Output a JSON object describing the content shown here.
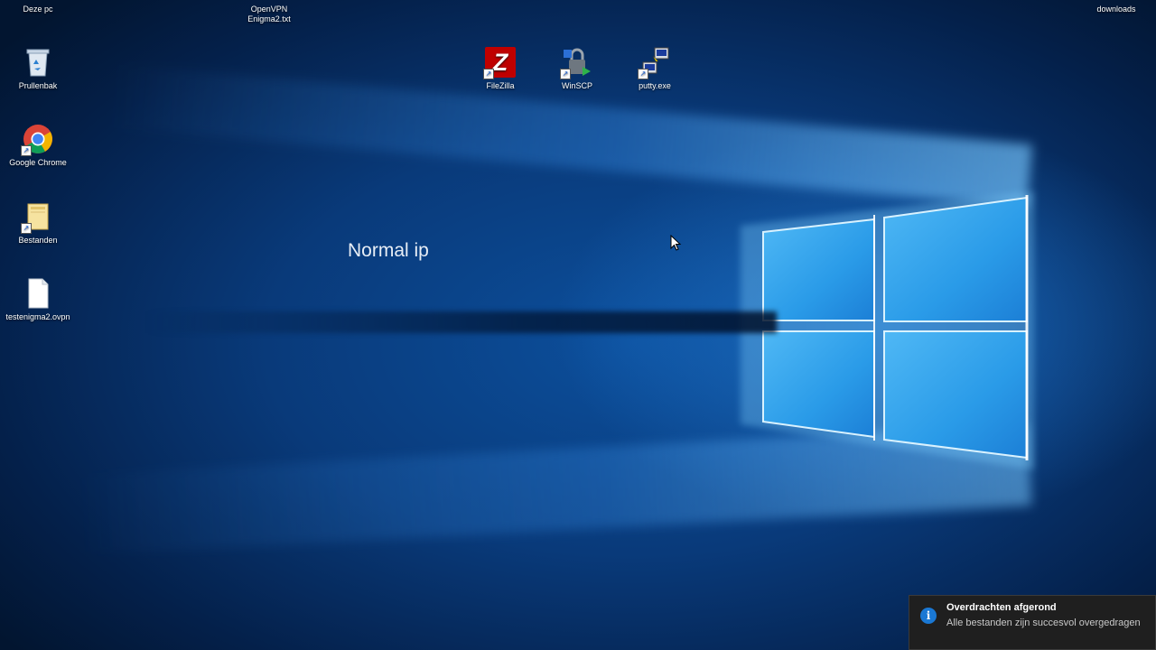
{
  "desktop": {
    "top_left_label": "Deze pc",
    "top_center_label_line1": "OpenVPN",
    "top_center_label_line2": "Enigma2.txt",
    "top_right_label": "downloads",
    "left_icons": [
      {
        "label": "Prullenbak",
        "icon": "recycle-bin-icon"
      },
      {
        "label": "Google Chrome",
        "icon": "chrome-icon"
      },
      {
        "label": "Bestanden",
        "icon": "folder-icon"
      },
      {
        "label": "testenigma2.ovpn",
        "icon": "file-icon"
      }
    ],
    "top_icons": [
      {
        "label": "FileZilla",
        "icon": "filezilla-icon",
        "glyph": "Z"
      },
      {
        "label": "WinSCP",
        "icon": "winscp-icon"
      },
      {
        "label": "putty.exe",
        "icon": "putty-icon"
      }
    ]
  },
  "overlay_text": "Normal ip",
  "toast": {
    "title": "Overdrachten afgerond",
    "body": "Alle bestanden zijn succesvol overgedragen",
    "icon": "info-icon",
    "icon_glyph": "i"
  },
  "colors": {
    "accent": "#1a78d4",
    "wallpaper_dark": "#04204a",
    "wallpaper_mid": "#0c4f9c",
    "toast_bg": "#1f1f1f"
  }
}
